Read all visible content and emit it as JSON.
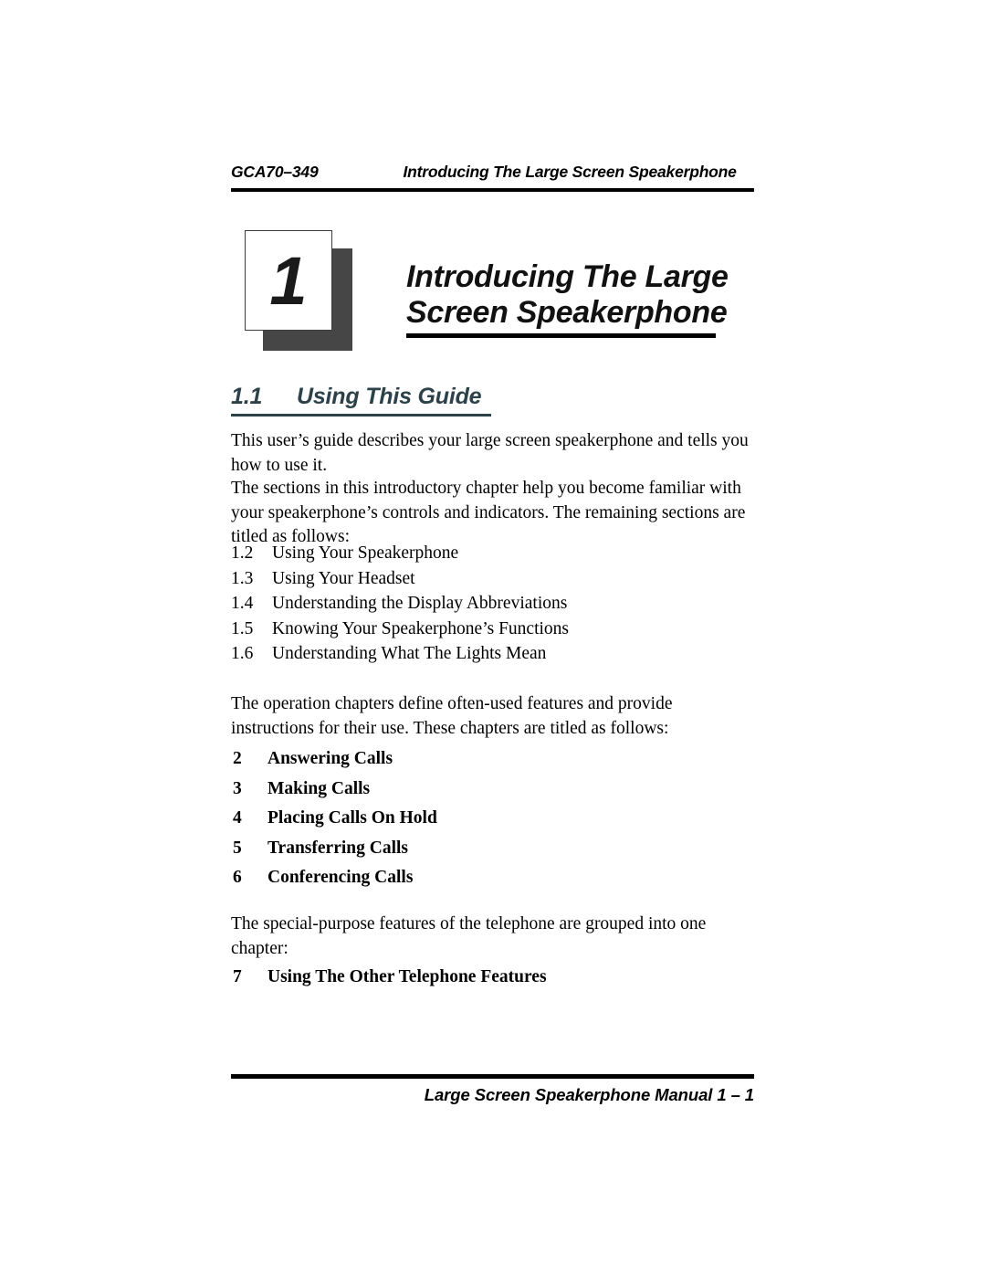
{
  "header": {
    "doc_id": "GCA70–349",
    "running_title": "Introducing The Large Screen Speakerphone"
  },
  "chapter": {
    "number": "1",
    "title_line1": "Introducing The Large",
    "title_line2": "Screen Speakerphone"
  },
  "section": {
    "number": "1.1",
    "title": "Using This Guide",
    "accent_color": "#2d4248"
  },
  "body": {
    "para1": "This user’s guide describes your large screen speakerphone and tells you how to use it.",
    "para2": "The sections in this introductory chapter help you become familiar with your speakerphone’s controls and indicators. The remaining sections are titled as follows:",
    "para3": "The operation chapters define often-used features and provide instructions for their use. These chapters are titled as follows:",
    "para4": "The special-purpose features of the telephone are grouped into one chapter:"
  },
  "section_list": [
    {
      "number": "1.2",
      "label": "Using Your Speakerphone"
    },
    {
      "number": "1.3",
      "label": "Using Your Headset"
    },
    {
      "number": "1.4",
      "label": "Understanding the Display Abbreviations"
    },
    {
      "number": "1.5",
      "label": "Knowing Your Speakerphone’s Functions"
    },
    {
      "number": "1.6",
      "label": "Understanding What The Lights Mean"
    }
  ],
  "chapter_list": [
    {
      "number": "2",
      "label": "Answering Calls"
    },
    {
      "number": "3",
      "label": "Making Calls"
    },
    {
      "number": "4",
      "label": "Placing Calls On Hold"
    },
    {
      "number": "5",
      "label": "Transferring Calls"
    },
    {
      "number": "6",
      "label": "Conferencing Calls"
    }
  ],
  "special_chapter_list": [
    {
      "number": "7",
      "label": "Using The Other Telephone Features"
    }
  ],
  "footer": {
    "text": "Large Screen Speakerphone Manual  1 – 1"
  }
}
